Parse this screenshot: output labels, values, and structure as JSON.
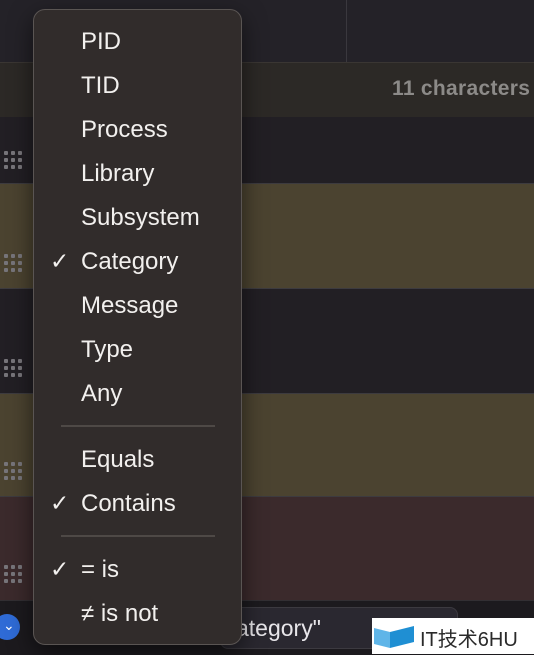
{
  "header": {
    "char_count": "11 characters"
  },
  "rows": [
    {
      "bg": "dark"
    },
    {
      "bg": "olive"
    },
    {
      "bg": "dark"
    },
    {
      "bg": "olive"
    },
    {
      "bg": "maroon"
    }
  ],
  "bottom": {
    "chevron_icon": "chevron-down-icon",
    "token_text": "ategory\""
  },
  "watermark": {
    "text": "IT技术6HU"
  },
  "menu": {
    "fields": [
      {
        "label": "PID",
        "checked": false
      },
      {
        "label": "TID",
        "checked": false
      },
      {
        "label": "Process",
        "checked": false
      },
      {
        "label": "Library",
        "checked": false
      },
      {
        "label": "Subsystem",
        "checked": false
      },
      {
        "label": "Category",
        "checked": true
      },
      {
        "label": "Message",
        "checked": false
      },
      {
        "label": "Type",
        "checked": false
      },
      {
        "label": "Any",
        "checked": false
      }
    ],
    "operators": [
      {
        "label": "Equals",
        "checked": false
      },
      {
        "label": "Contains",
        "checked": true
      }
    ],
    "comparisons": [
      {
        "label": "= is",
        "checked": true
      },
      {
        "label": "≠ is not",
        "checked": false
      }
    ],
    "check_glyph": "✓"
  }
}
